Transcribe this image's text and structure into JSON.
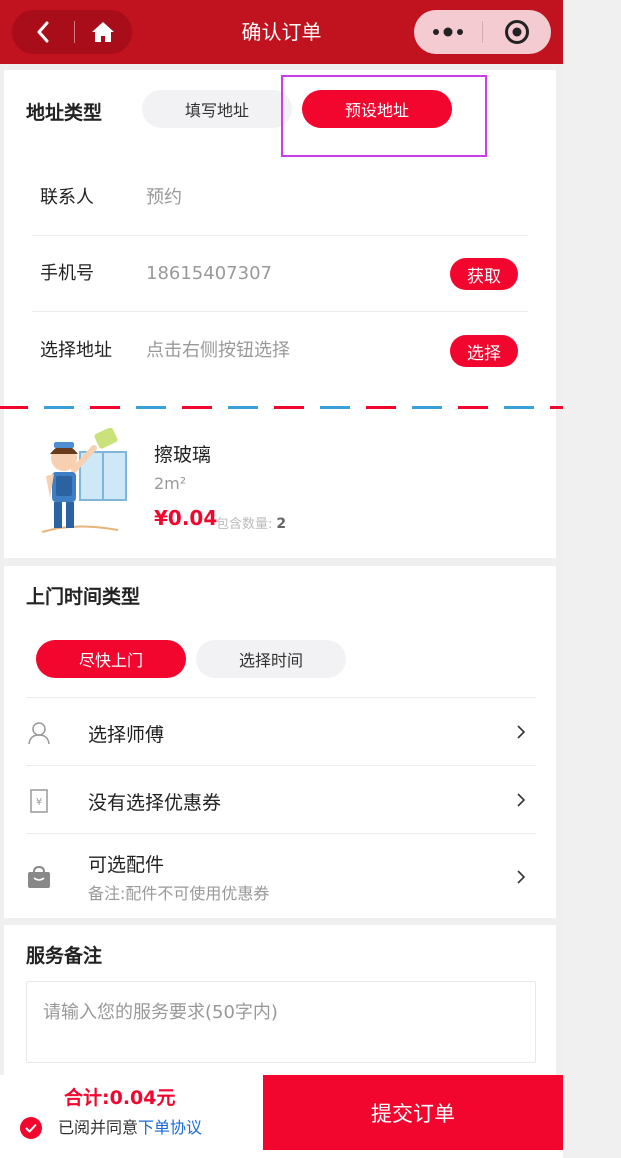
{
  "nav": {
    "title": "确认订单",
    "back_icon": "chevron-left-icon",
    "home_icon": "home-icon",
    "more_icon": "more-dots-icon",
    "close_icon": "target-icon"
  },
  "address": {
    "type_label": "地址类型",
    "tabs": [
      {
        "label": "填写地址",
        "active": false
      },
      {
        "label": "预设地址",
        "active": true
      }
    ],
    "contact": {
      "label": "联系人",
      "value": "预约"
    },
    "phone": {
      "label": "手机号",
      "value": "18615407307",
      "button": "获取"
    },
    "location": {
      "label": "选择地址",
      "value": "点击右侧按钮选择",
      "button": "选择"
    }
  },
  "product": {
    "name": "擦玻璃",
    "spec": "2m²",
    "price": "¥0.04",
    "qty_label": "包含数量:",
    "qty_value": "2"
  },
  "visit_time": {
    "title": "上门时间类型",
    "tabs": [
      {
        "label": "尽快上门",
        "active": true
      },
      {
        "label": "选择时间",
        "active": false
      }
    ],
    "rows": [
      {
        "label": "选择师傅",
        "icon": "worker-icon"
      },
      {
        "label": "没有选择优惠券",
        "icon": "coupon-icon"
      },
      {
        "label": "可选配件",
        "sub": "备注:配件不可使用优惠券",
        "icon": "bag-icon"
      }
    ]
  },
  "remark": {
    "title": "服务备注",
    "placeholder": "请输入您的服务要求(50字内)"
  },
  "footer": {
    "total": "合计:0.04元",
    "agree_text": "已阅并同意",
    "agree_link": "下单协议",
    "submit": "提交订单"
  },
  "colors": {
    "nav_bg": "#c0121f",
    "accent": "#f3062e",
    "link": "#1a6ad8",
    "highlight": "#cc3ee6"
  }
}
